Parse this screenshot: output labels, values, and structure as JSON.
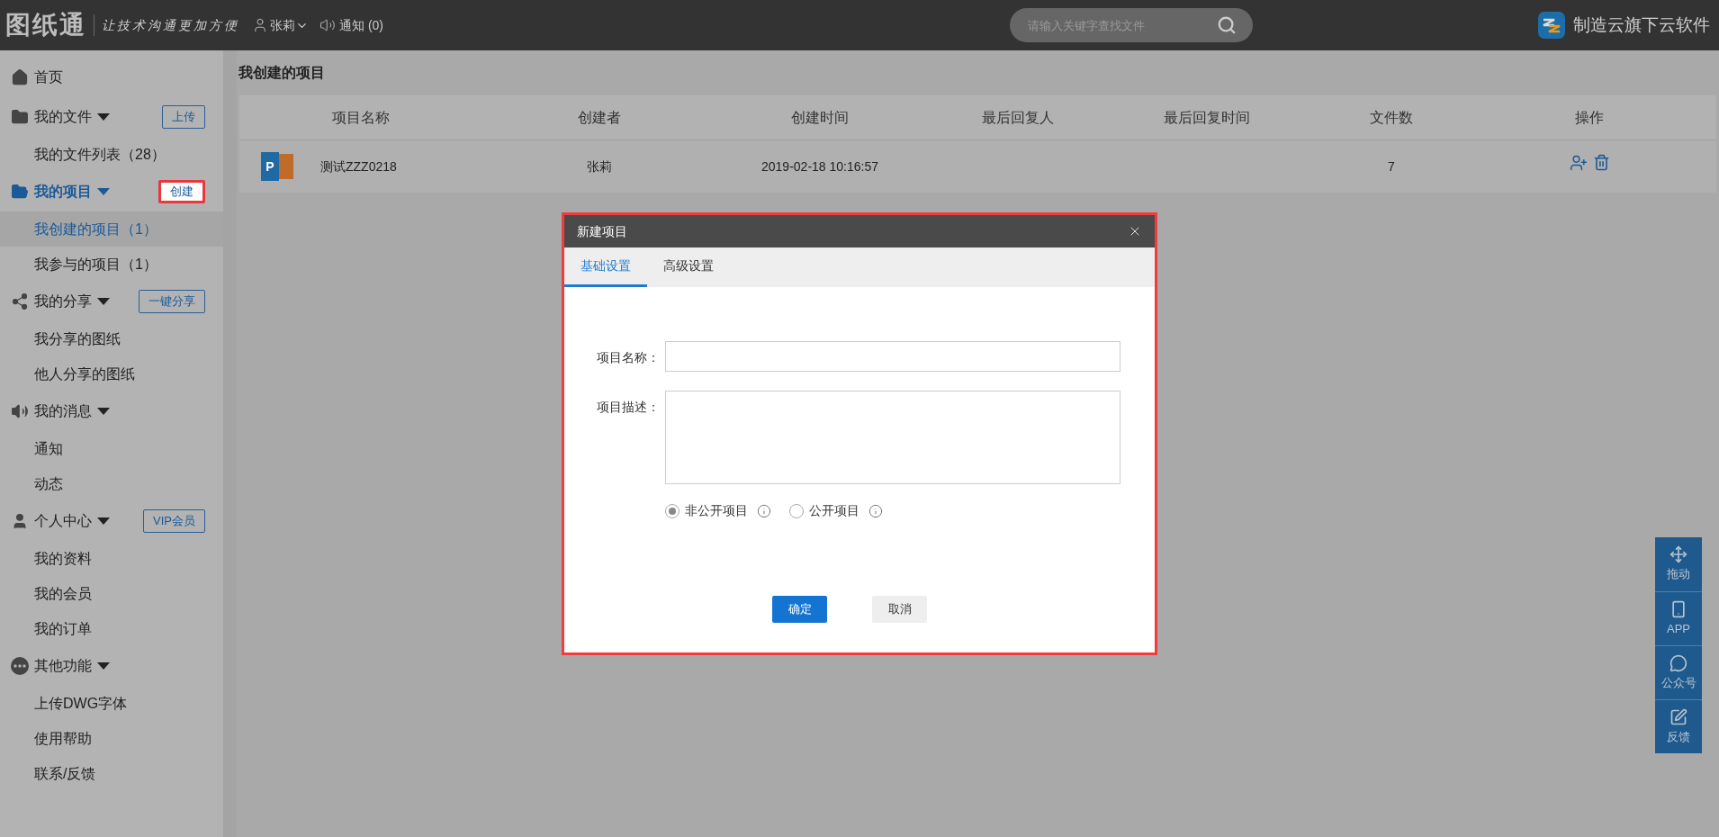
{
  "header": {
    "logo": "图纸通",
    "slogan": "让技术沟通更加方便",
    "user": "张莉",
    "notice": "通知 (0)",
    "search_placeholder": "请输入关键字查找文件",
    "brand": "制造云旗下云软件"
  },
  "sidebar": [
    {
      "label": "首页",
      "selected": false
    },
    {
      "label": "我的文件",
      "selected": false,
      "action": {
        "label": "上传",
        "highlighted": false
      },
      "children": [
        {
          "label": "我的文件列表（28）",
          "selected": false
        }
      ]
    },
    {
      "label": "我的项目",
      "selected": true,
      "action": {
        "label": "创建",
        "highlighted": true
      },
      "children": [
        {
          "label": "我创建的项目（1）",
          "selected": true
        },
        {
          "label": "我参与的项目（1）",
          "selected": false
        }
      ]
    },
    {
      "label": "我的分享",
      "selected": false,
      "action": {
        "label": "一键分享",
        "highlighted": false
      },
      "children": [
        {
          "label": "我分享的图纸",
          "selected": false
        },
        {
          "label": "他人分享的图纸",
          "selected": false
        }
      ]
    },
    {
      "label": "我的消息",
      "selected": false,
      "children": [
        {
          "label": "通知",
          "selected": false
        },
        {
          "label": "动态",
          "selected": false
        }
      ]
    },
    {
      "label": "个人中心",
      "selected": false,
      "action": {
        "label": "VIP会员",
        "highlighted": false
      },
      "children": [
        {
          "label": "我的资料",
          "selected": false
        },
        {
          "label": "我的会员",
          "selected": false
        },
        {
          "label": "我的订单",
          "selected": false
        }
      ]
    },
    {
      "label": "其他功能",
      "selected": false,
      "children": [
        {
          "label": "上传DWG字体",
          "selected": false
        },
        {
          "label": "使用帮助",
          "selected": false
        },
        {
          "label": "联系/反馈",
          "selected": false
        }
      ]
    }
  ],
  "page_title": "我创建的项目",
  "table": {
    "columns": [
      "项目名称",
      "创建者",
      "创建时间",
      "最后回复人",
      "最后回复时间",
      "文件数",
      "操作"
    ],
    "rows": [
      {
        "file_badge": "P",
        "name": "测试ZZZ0218",
        "creator": "张莉",
        "created": "2019-02-18 10:16:57",
        "files": "7"
      }
    ]
  },
  "dialog": {
    "title": "新建项目",
    "tabs": [
      {
        "label": "基础设置",
        "selected": true
      },
      {
        "label": "高级设置",
        "selected": false
      }
    ],
    "fields": [
      {
        "label": "项目名称：",
        "kind": "input"
      },
      {
        "label": "项目描述：",
        "kind": "textarea"
      }
    ],
    "visibility": [
      {
        "label": "非公开项目",
        "selected": true
      },
      {
        "label": "公开项目",
        "selected": false
      }
    ],
    "buttons": [
      {
        "label": "确定",
        "kind": "primary"
      },
      {
        "label": "取消",
        "kind": "secondary"
      }
    ]
  },
  "float_bar": [
    "拖动",
    "APP",
    "公众号",
    "反馈"
  ]
}
